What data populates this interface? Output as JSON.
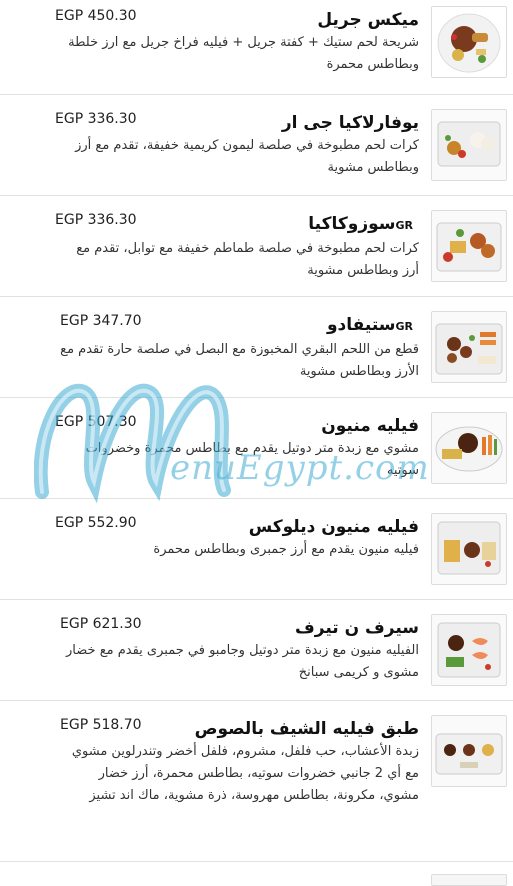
{
  "menu": {
    "items": [
      {
        "name": "ميكس جريل",
        "badge": "",
        "price": "EGP 450.30",
        "description": "شريحة لحم ستيك + كفتة جريل + فيليه فراخ جريل مع ارز خلطة وبطاطس محمرة"
      },
      {
        "name": "يوفارلاكيا جى ار",
        "badge": "",
        "price": "EGP 336.30",
        "description": "كرات لحم مطبوخة في صلصة ليمون كريمية خفيفة، تقدم مع أرز وبطاطس مشوية"
      },
      {
        "name": "سوزوكاكيا",
        "badge": "GR",
        "price": "EGP 336.30",
        "description": "كرات لحم مطبوخة في صلصة طماطم خفيفة مع توابل، تقدم مع أرز وبطاطس مشوية"
      },
      {
        "name": "ستيفادو",
        "badge": "GR",
        "price": "EGP 347.70",
        "description": "قطع من اللحم البقري المخبوزة مع البصل في صلصة حارة تقدم مع الأرز وبطاطس مشوية"
      },
      {
        "name": "فيليه منيون",
        "badge": "",
        "price": "EGP 507.30",
        "description": "مشوي مع زبدة متر دوتيل يقدم مع بطاطس محمرة وخضروات سوتيه"
      },
      {
        "name": "فيليه منيون ديلوكس",
        "badge": "",
        "price": "EGP 552.90",
        "description": "فيليه منيون يقدم مع أرز جمبرى وبطاطس محمرة"
      },
      {
        "name": "سيرف ن تيرف",
        "badge": "",
        "price": "EGP 621.30",
        "description": "الفيليه منيون مع زبدة متر دوتيل وجامبو في جمبرى يقدم مع خضار مشوى و كريمى سبانخ"
      },
      {
        "name": "طبق فيليه الشيف بالصوص",
        "badge": "",
        "price": "EGP 518.70",
        "description": "زبدة الأعشاب، حب فلفل، مشروم، فلفل أخضر وتندرلوين مشوي مع أي 2 جانبي خضروات سوتيه، بطاطس محمرة، أرز خضار مشوي، مكرونة، بطاطس مهروسة، ذرة مشوية، ماك اند تشيز"
      }
    ]
  },
  "watermark": {
    "text": "enuEgypt.com",
    "color": "#3caad2"
  }
}
